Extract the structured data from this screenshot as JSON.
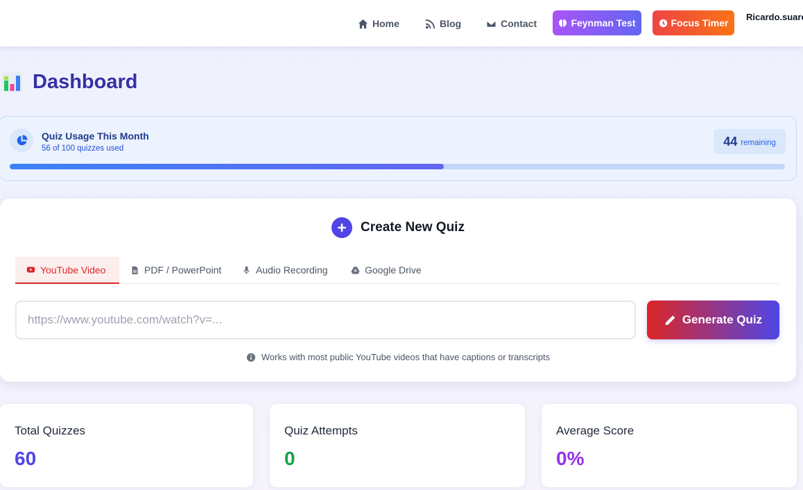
{
  "nav": {
    "links": [
      {
        "label": "Home",
        "icon": "home-icon"
      },
      {
        "label": "Blog",
        "icon": "rss-icon"
      },
      {
        "label": "Contact",
        "icon": "envelope-icon"
      }
    ],
    "feynman_label": "Feynman Test",
    "focus_label": "Focus Timer",
    "username": "Ricardo.suare"
  },
  "dashboard": {
    "title": "Dashboard",
    "icon": "bar-chart-emoji-icon"
  },
  "usage": {
    "title": "Quiz Usage This Month",
    "subtitle": "56 of 100 quizzes used",
    "used": 56,
    "limit": 100,
    "remaining_count": "44",
    "remaining_label": "remaining",
    "progress_fraction": 0.56
  },
  "create_quiz": {
    "title": "Create New Quiz",
    "tabs": [
      {
        "label": "YouTube Video",
        "icon": "youtube-icon",
        "active": true
      },
      {
        "label": "PDF / PowerPoint",
        "icon": "file-pdf-icon",
        "active": false
      },
      {
        "label": "Audio Recording",
        "icon": "microphone-icon",
        "active": false
      },
      {
        "label": "Google Drive",
        "icon": "google-drive-icon",
        "active": false
      }
    ],
    "url_placeholder": "https://www.youtube.com/watch?v=...",
    "url_value": "",
    "generate_label": "Generate Quiz",
    "hint": "Works with most public YouTube videos that have captions or transcripts"
  },
  "stats": [
    {
      "label": "Total Quizzes",
      "value": "60",
      "color": "#4f46e5"
    },
    {
      "label": "Quiz Attempts",
      "value": "0",
      "color": "#16a34a"
    },
    {
      "label": "Average Score",
      "value": "0%",
      "color": "#9333ea"
    }
  ],
  "colors": {
    "accent": "#4f46e5",
    "title": "#3730a3",
    "danger": "#dc2626"
  }
}
